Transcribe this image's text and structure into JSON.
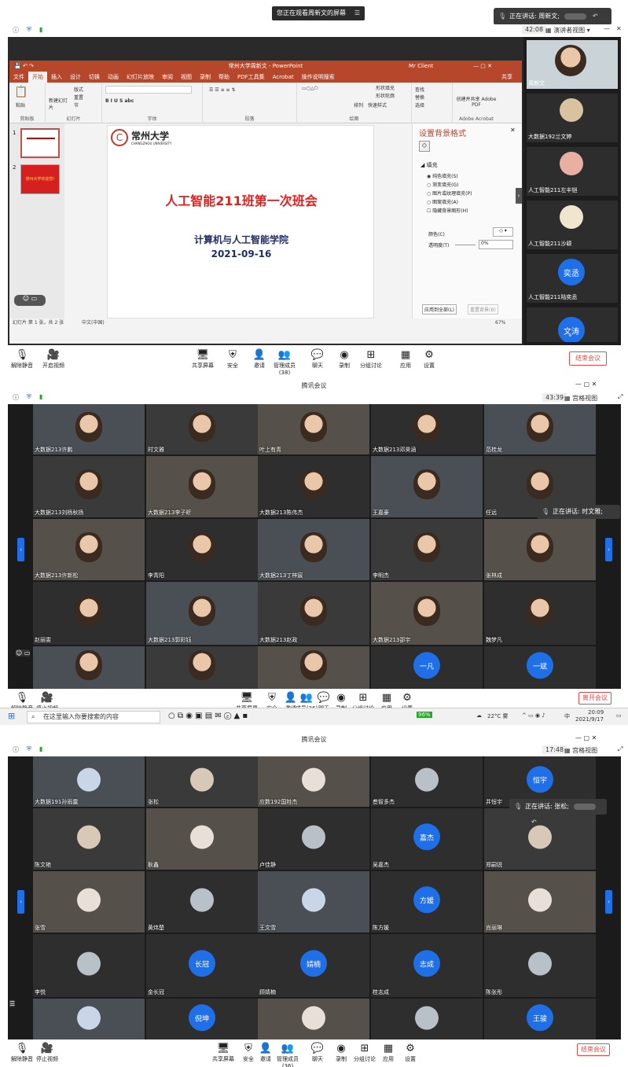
{
  "sec1": {
    "notice": "您正在观看周新文的屏幕",
    "speaking_label": "正在讲话: 周新文;",
    "timer": "42:08",
    "view_mode": "演讲者视图",
    "ppt": {
      "window_title": "常州大学周新文 - PowerPoint",
      "account": "Mr Client",
      "tabs": [
        "文件",
        "开始",
        "插入",
        "设计",
        "切换",
        "动画",
        "幻灯片放映",
        "审阅",
        "视图",
        "录制",
        "帮助",
        "PDF工具集",
        "Acrobat",
        "操作说明搜索"
      ],
      "share_label": "共享",
      "ribbon_groups": [
        "剪贴板",
        "幻灯片",
        "字体",
        "段落",
        "绘图",
        "Adobe Acrobat"
      ],
      "ribbon_items": {
        "paste": "粘贴",
        "new_slide": "新建幻灯片",
        "layout": "版式",
        "reset": "重置",
        "section": "节",
        "arrange": "排列",
        "quick_styles": "快速样式",
        "shape_fill": "形状填充",
        "shape_outline": "形状轮廓",
        "shape_effect": "形状效果",
        "find": "查找",
        "replace": "替换",
        "select": "选择",
        "create_pdf": "创建并共享 Adobe PDF"
      },
      "slide_thumb2_text": "常州大学欢迎您!",
      "university_logo_text": "常州大学",
      "university_en": "CHANGZHOU UNIVERSITY",
      "slide_title": "人工智能211班第一次班会",
      "slide_school": "计算机与人工智能学院",
      "slide_date": "2021-09-16",
      "pane_title": "设置背景格式",
      "pane_section": "填充",
      "fill_options": [
        "纯色填充(S)",
        "渐变填充(G)",
        "图片或纹理填充(P)",
        "图案填充(A)",
        "隐藏背景图形(H)"
      ],
      "color_label": "颜色(C)",
      "transparency_label": "透明度(T)",
      "transparency_value": "0%",
      "apply_all": "应用到全部(L)",
      "reset_bg": "重置背景(B)",
      "status_left": "幻灯片 第 1 张，共 2 张",
      "status_lang": "中文(中国)",
      "status_zoom": "67%"
    },
    "speakers": [
      {
        "name": "周新文"
      },
      {
        "name": "大数据192兰文婷"
      },
      {
        "name": "人工智能211左丰铠"
      },
      {
        "name": "人工智能211沙颖"
      },
      {
        "name": "人工智能211陆奕丞",
        "avatar": "奕丞"
      },
      {
        "name": "",
        "avatar": "文涛"
      }
    ],
    "toolbar": [
      "解除静音",
      "开启视频",
      "共享屏幕",
      "安全",
      "邀请",
      "管理成员(38)",
      "聊天",
      "录制",
      "分组讨论",
      "应用",
      "设置"
    ],
    "end_button": "结束会议"
  },
  "sec2": {
    "title": "腾讯会议",
    "timer": "43:39",
    "view_mode": "宫格视图",
    "speaking_label": "正在讲话: 时文雅;",
    "tiles": [
      [
        "大数据213许鹏",
        "时文雅",
        "叶上有青",
        "大数据213邓昊涵",
        "范桂龙"
      ],
      [
        "大数据213刘杨秋扬",
        "大数据213李子昕",
        "大数据213陈伟杰",
        "王嘉豪",
        "任远"
      ],
      [
        "大数据213许新松",
        "李青阳",
        "大数据213丁梓宸",
        "李明杰",
        "张林成"
      ],
      [
        "赵丽雯",
        "大数据213郭彩钰",
        "大数据213赵政",
        "大数据213邵宇",
        "魏梦凡"
      ],
      [
        "",
        "",
        "",
        "一凡",
        "一斌"
      ]
    ],
    "avatars_row5": [
      "一凡",
      "一斌"
    ],
    "toolbar": [
      "解除静音",
      "停止视频",
      "共享屏幕",
      "安全",
      "邀请",
      "成员(36)",
      "聊天",
      "录制",
      "分组讨论",
      "应用",
      "设置"
    ],
    "end_button": "离开会议",
    "taskbar": {
      "search_placeholder": "在这里输入你要搜索的内容",
      "weather": "22°C 雾",
      "ime": "中",
      "time": "20:09",
      "date": "2021/9/17",
      "battery": "96%"
    }
  },
  "sec3": {
    "title": "腾讯会议",
    "timer": "17:48",
    "view_mode": "宫格视图",
    "speaking_label": "正在讲话: 张松;",
    "tiles": [
      [
        "大数据191孙雨露",
        "张松",
        "应数192国姓杰",
        "叁智多杰",
        "井恒宇"
      ],
      [
        "陈文艳",
        "耿鑫",
        "卢佳静",
        "吴嘉杰",
        "郑嗣锐"
      ],
      [
        "张雪",
        "黄炜楚",
        "王文雪",
        "陈方媛",
        "肖丽琳"
      ],
      [
        "李悦",
        "金长冠",
        "顾婧楠",
        "桂志成",
        "陈张彤"
      ],
      [
        "",
        "",
        "",
        "",
        ""
      ]
    ],
    "avatars": {
      "r0c4": "恒宇",
      "r1c3": "嘉杰",
      "r2c3": "方媛",
      "r3c1": "长冠",
      "r3c2": "婧楠",
      "r3c3": "志成",
      "r4c1": "倪坤",
      "r4c4": "王骏"
    },
    "toolbar": [
      "解除静音",
      "停止视频",
      "共享屏幕",
      "安全",
      "邀请",
      "管理成员(36)",
      "聊天",
      "录制",
      "分组讨论",
      "应用",
      "设置"
    ],
    "end_button": "结束会议"
  }
}
